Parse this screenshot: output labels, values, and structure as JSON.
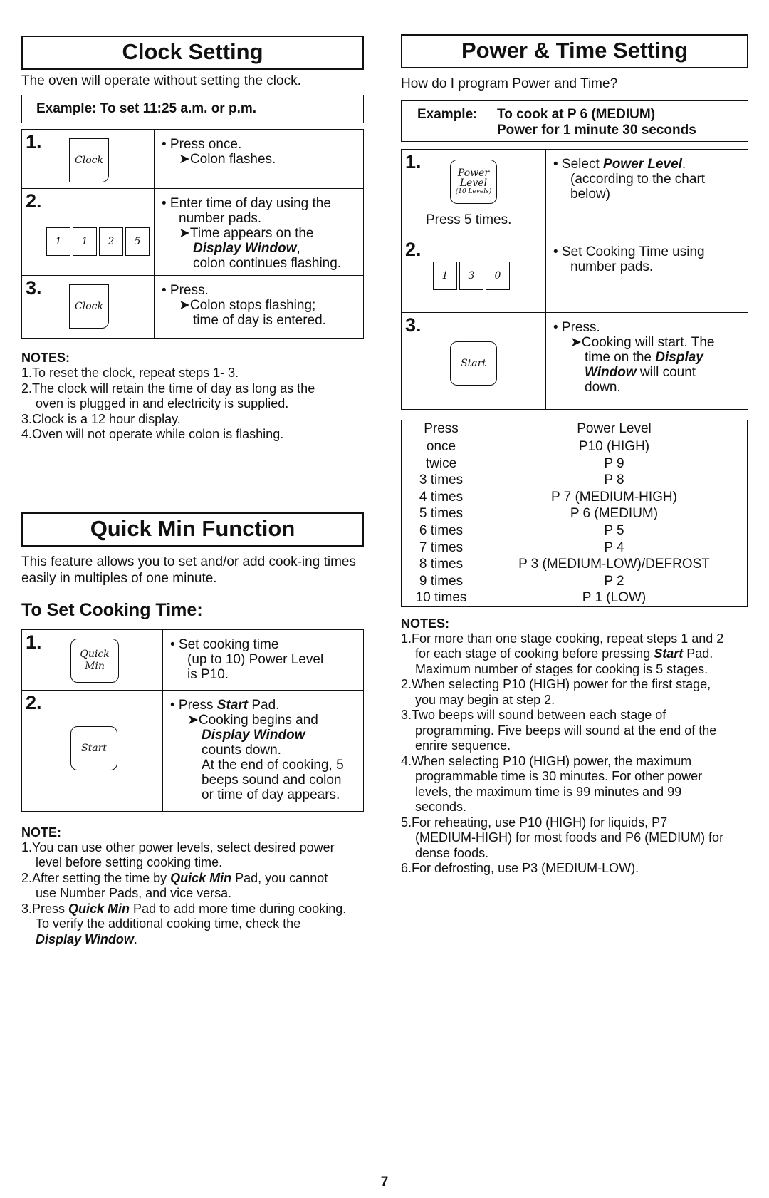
{
  "clock_setting": {
    "title": "Clock Setting",
    "intro": "The oven will operate without setting the clock.",
    "example": "Example:  To set 11:25 a.m. or p.m.",
    "steps": [
      {
        "num": "1.",
        "pad": "Clock",
        "lines": [
          "• Press once.",
          "➤Colon flashes."
        ]
      },
      {
        "num": "2.",
        "pads": [
          "1",
          "1",
          "2",
          "5"
        ],
        "lines": [
          "• Enter time of day using the",
          "number pads.",
          "➤Time appears on the",
          "Display Window",
          ",",
          "colon continues flashing."
        ]
      },
      {
        "num": "3.",
        "pad": "Clock",
        "lines": [
          "• Press.",
          "➤Colon stops flashing;",
          "time of day is entered."
        ]
      }
    ],
    "notes_heading": "NOTES:",
    "notes": [
      "1.To reset the clock, repeat steps 1- 3.",
      "2.The clock will retain the time of day as long as the oven is plugged in and electricity is supplied.",
      "3.Clock is a 12 hour display.",
      "4.Oven will not operate while colon is flashing."
    ]
  },
  "quick_min": {
    "title": "Quick Min Function",
    "intro": "This feature allows you to set and/or add cook-ing times easily in multiples of one minute.",
    "subheading": "To Set Cooking Time:",
    "steps": [
      {
        "num": "1.",
        "pad_line1": "Quick",
        "pad_line2": "Min",
        "lines": [
          "• Set cooking time",
          "(up to 10) Power Level",
          "is P10."
        ]
      },
      {
        "num": "2.",
        "pad": "Start",
        "lines": [
          "• Press ",
          "Start",
          " Pad.",
          "➤Cooking begins and",
          "Display Window",
          "counts down.",
          "At the end of cooking, 5",
          "beeps sound and colon",
          "or time of day appears."
        ]
      }
    ],
    "notes_heading": "NOTE:",
    "notes": [
      {
        "pre": "1.You can use other power levels, select desired power level before setting cooking time.",
        "em": "",
        "post": ""
      },
      {
        "pre": "2.After setting the time by ",
        "em": "Quick Min",
        "post": " Pad, you cannot use Number Pads, and vice versa."
      },
      {
        "pre": "3.Press ",
        "em": "Quick Min",
        "post": " Pad to add more time during cooking. To verify the additional cooking time, check the ",
        "em2": "Display Window",
        "post2": "."
      }
    ]
  },
  "power_time": {
    "title": "Power & Time Setting",
    "intro": "How do I program Power and Time?",
    "example_label": "Example:",
    "example_line1": "To cook at P 6 (MEDIUM)",
    "example_line2": "Power for 1 minute 30 seconds",
    "steps": [
      {
        "num": "1.",
        "pad_line1": "Power",
        "pad_line2": "Level",
        "pad_line3": "(10 Levels)",
        "caption": "Press 5 times.",
        "lines": [
          "• Select ",
          "Power Level",
          ".",
          "(according to the chart",
          "below)"
        ]
      },
      {
        "num": "2.",
        "pads": [
          "1",
          "3",
          "0"
        ],
        "lines": [
          "• Set Cooking Time using",
          "number pads."
        ]
      },
      {
        "num": "3.",
        "pad": "Start",
        "lines": [
          "• Press.",
          "➤Cooking will start. The",
          "time on the ",
          "Display",
          "Window",
          " will count",
          "down."
        ]
      }
    ],
    "table": {
      "headers": [
        "Press",
        "Power Level"
      ],
      "rows": [
        [
          "once",
          "P10 (HIGH)"
        ],
        [
          "twice",
          "P 9"
        ],
        [
          "3 times",
          "P 8"
        ],
        [
          "4 times",
          "P 7 (MEDIUM-HIGH)"
        ],
        [
          "5 times",
          "P 6 (MEDIUM)"
        ],
        [
          "6 times",
          "P 5"
        ],
        [
          "7 times",
          "P 4"
        ],
        [
          "8 times",
          "P 3 (MEDIUM-LOW)/DEFROST"
        ],
        [
          "9 times",
          "P 2"
        ],
        [
          "10 times",
          "P 1 (LOW)"
        ]
      ]
    },
    "notes_heading": "NOTES:",
    "notes": [
      {
        "pre": "1.For more than one stage cooking, repeat steps 1 and 2 for each stage of cooking before pressing ",
        "em": "Start",
        "post": " Pad. Maximum number of stages for cooking is 5 stages."
      },
      {
        "pre": "2.When selecting P10 (HIGH) power for the first stage, you may begin at step 2.",
        "em": "",
        "post": ""
      },
      {
        "pre": "3.Two beeps will sound between each stage of programming. Five beeps will sound at the end of the enrire sequence.",
        "em": "",
        "post": ""
      },
      {
        "pre": "4.When selecting P10 (HIGH) power, the maximum programmable time is 30 minutes. For other power levels, the maximum time is 99 minutes and 99 seconds.",
        "em": "",
        "post": ""
      },
      {
        "pre": "5.For reheating, use P10 (HIGH) for liquids, P7 (MEDIUM-HIGH) for most foods and P6 (MEDIUM) for dense foods.",
        "em": "",
        "post": ""
      },
      {
        "pre": "6.For defrosting, use P3 (MEDIUM-LOW).",
        "em": "",
        "post": ""
      }
    ]
  },
  "page_number": "7"
}
